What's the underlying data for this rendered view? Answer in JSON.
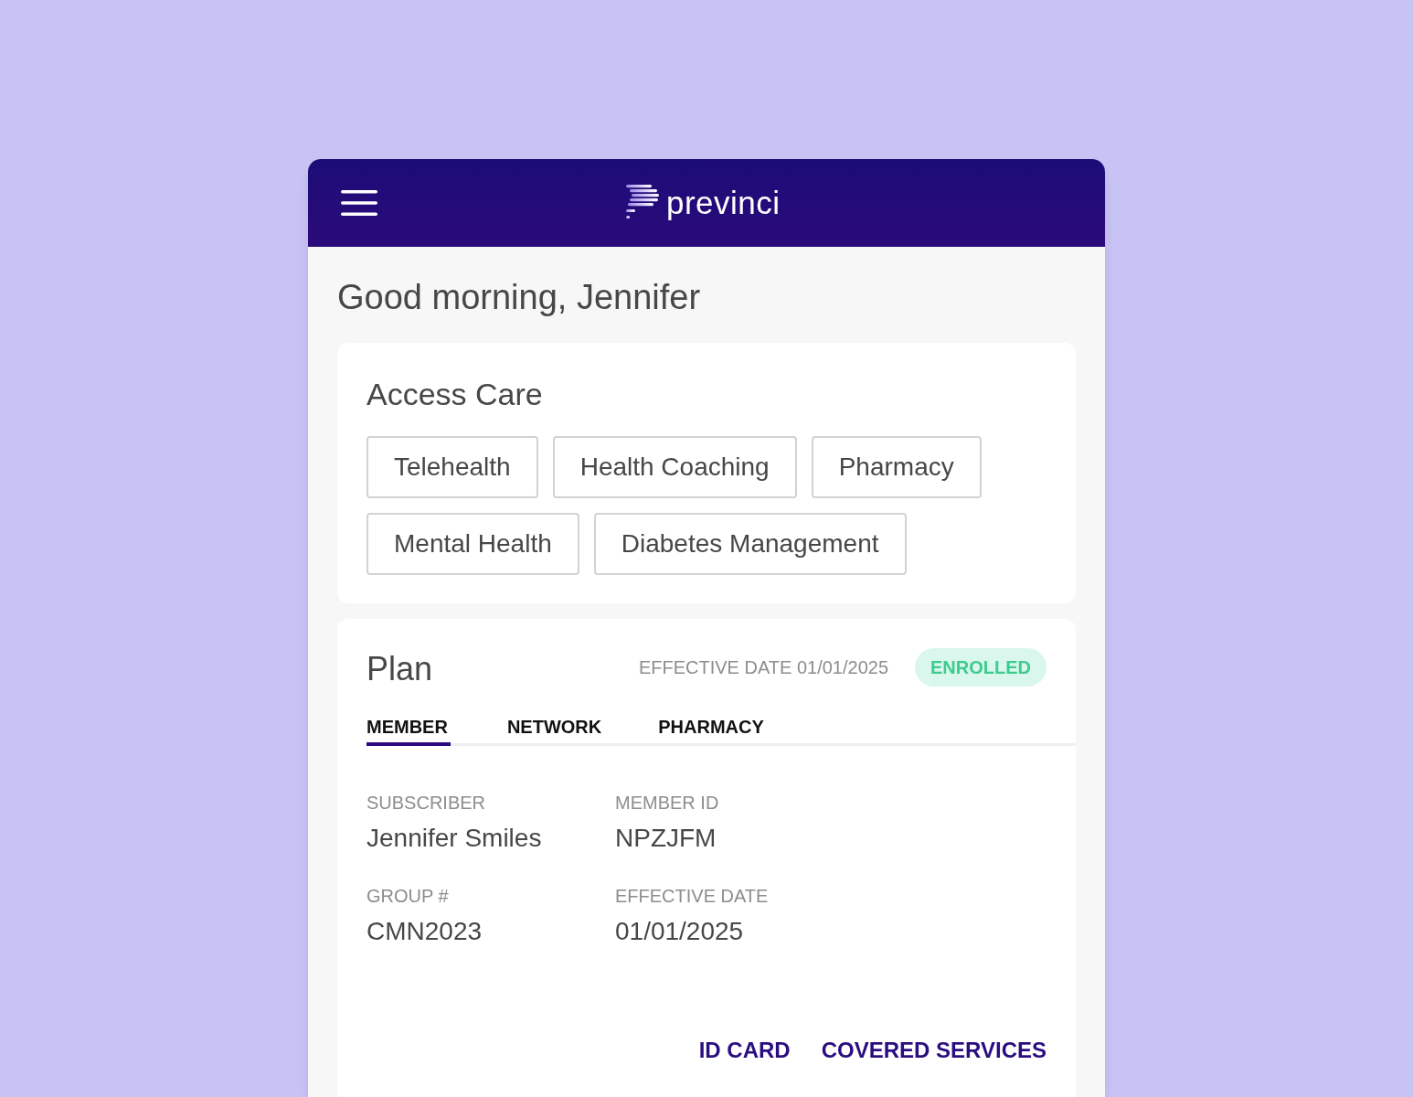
{
  "header": {
    "logo_text": "previnci"
  },
  "greeting": "Good morning, Jennifer",
  "access_care": {
    "title": "Access Care",
    "services": [
      "Telehealth",
      "Health Coaching",
      "Pharmacy",
      "Mental Health",
      "Diabetes Management"
    ]
  },
  "plan": {
    "title": "Plan",
    "effective_date": "EFFECTIVE DATE 01/01/2025",
    "status": "ENROLLED",
    "tabs": [
      {
        "label": "MEMBER",
        "selected": true
      },
      {
        "label": "NETWORK",
        "selected": false
      },
      {
        "label": "PHARMACY",
        "selected": false
      }
    ],
    "fields": [
      {
        "label": "SUBSCRIBER",
        "value": "Jennifer Smiles"
      },
      {
        "label": "MEMBER ID",
        "value": "NPZJFM"
      },
      {
        "label": "GROUP #",
        "value": "CMN2023"
      },
      {
        "label": "EFFECTIVE DATE",
        "value": "01/01/2025"
      }
    ],
    "links": [
      "ID CARD",
      "COVERED SERVICES"
    ]
  }
}
